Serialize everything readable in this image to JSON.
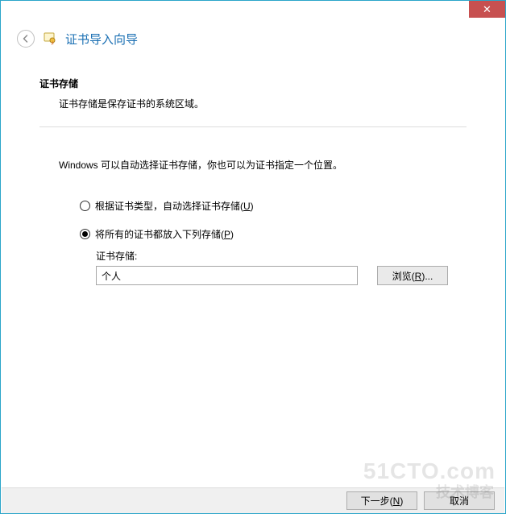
{
  "window": {
    "close_glyph": "✕"
  },
  "header": {
    "title": "证书导入向导"
  },
  "section": {
    "heading": "证书存储",
    "description": "证书存储是保存证书的系统区域。"
  },
  "instruction": "Windows 可以自动选择证书存储，你也可以为证书指定一个位置。",
  "options": {
    "auto_prefix": "根据证书类型，自动选择证书存储(",
    "auto_key": "U",
    "auto_suffix": ")",
    "place_prefix": "将所有的证书都放入下列存储(",
    "place_key": "P",
    "place_suffix": ")"
  },
  "store": {
    "label": "证书存储:",
    "value": "个人",
    "browse_prefix": "浏览(",
    "browse_key": "R",
    "browse_suffix": ")..."
  },
  "footer": {
    "next_prefix": "下一步(",
    "next_key": "N",
    "next_suffix": ")",
    "cancel": "取消"
  },
  "watermark": {
    "line1": "51CTO.com",
    "line2": "技术博客"
  }
}
